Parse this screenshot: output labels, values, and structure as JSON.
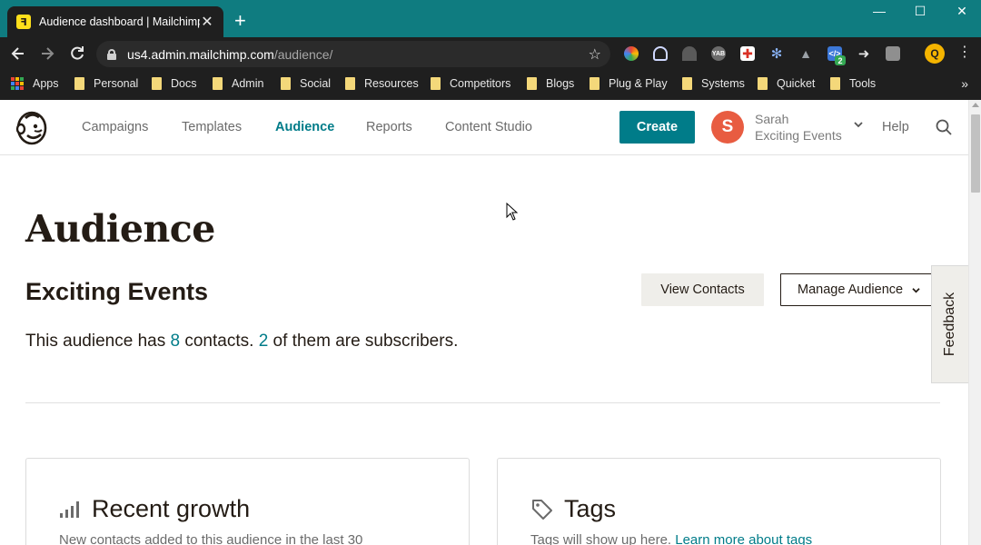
{
  "browser": {
    "tab_title": "Audience dashboard | Mailchimp",
    "tab_close": "✕",
    "new_tab": "+",
    "url_host": "us4.admin.mailchimp.com",
    "url_path": "/audience/",
    "window": {
      "minimize": "—",
      "maximize": "☐",
      "close": "✕"
    },
    "bookmarks": [
      "Apps",
      "Personal",
      "Docs",
      "Admin",
      "Social",
      "Resources",
      "Competitors",
      "Blogs",
      "Plug & Play",
      "Systems",
      "Quicket",
      "Tools"
    ],
    "bookmarks_more": "»",
    "extensions_badge": "2"
  },
  "header": {
    "nav": [
      "Campaigns",
      "Templates",
      "Audience",
      "Reports",
      "Content Studio"
    ],
    "active_nav": "Audience",
    "create_label": "Create",
    "account_initial": "S",
    "account_name": "Sarah",
    "account_org": "Exciting Events",
    "help_label": "Help"
  },
  "page": {
    "title": "Audience",
    "audience_name": "Exciting Events",
    "view_contacts_label": "View Contacts",
    "manage_audience_label": "Manage Audience",
    "summary_prefix": "This audience has ",
    "contacts_count": "8",
    "summary_middle": " contacts. ",
    "subscribers_count": "2",
    "summary_suffix": " of them are subscribers.",
    "feedback_label": "Feedback"
  },
  "cards": {
    "growth_title": "Recent growth",
    "growth_text": "New contacts added to this audience in the last 30",
    "tags_title": "Tags",
    "tags_text": "Tags will show up here.",
    "tags_link": "Learn more about tags"
  },
  "colors": {
    "brand_teal": "#007c89",
    "tab_strip": "#0f7c80",
    "avatar": "#e85c41"
  }
}
